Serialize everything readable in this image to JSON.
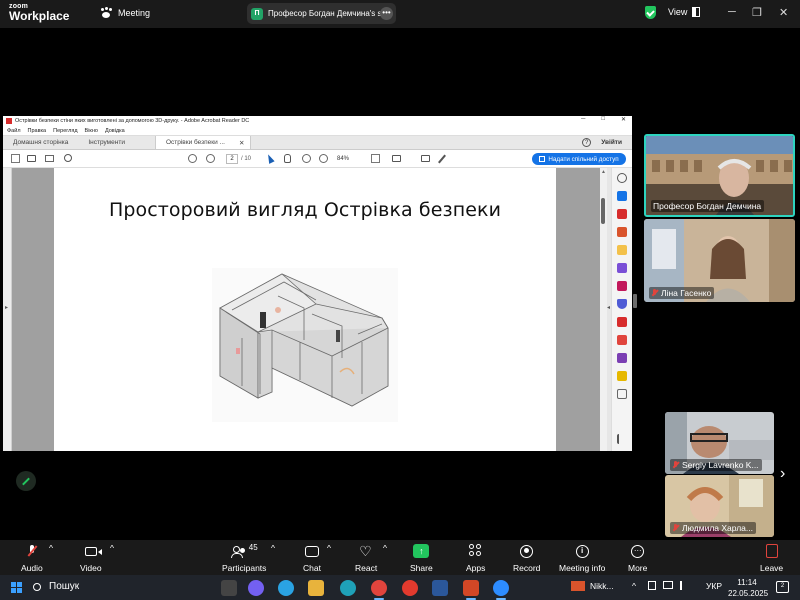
{
  "zoom": {
    "logo_line1": "zoom",
    "logo_line2": "Workplace",
    "meeting_label": "Meeting",
    "share_pill_initial": "П",
    "share_pill_text": "Професор Богдан Демчина's sc",
    "share_pill_more": "•••",
    "view_label": "View",
    "win_controls": [
      "─",
      "❐",
      "✕"
    ]
  },
  "acrobat": {
    "window_title": "Острівки безпеки стіни яких виготовлені за допомогою 3D-друку. - Adobe Acrobat Reader DC",
    "window_controls": [
      "─",
      "□",
      "✕"
    ],
    "menu": [
      "Файл",
      "Правка",
      "Перегляд",
      "Вікно",
      "Довідка"
    ],
    "tabs": [
      "Домашня сторінка",
      "Інструменти"
    ],
    "active_tab": "Острівки безпеки ...",
    "tab_close": "✕",
    "help_label": "?",
    "signin_label": "Увійти",
    "current_page": "2",
    "page_total": "/ 10",
    "zoom_value": "84%",
    "share_button": "Надати спільний доступ",
    "slide_title": "Просторовий вигляд Острівка безпеки",
    "left_arrow": "▸",
    "right_arrow": "◂",
    "scroll_up": "▲"
  },
  "participants": [
    {
      "name": "Професор Богдан Демчина",
      "muted": false
    },
    {
      "name": "Ліна Гасенко",
      "muted": true
    },
    {
      "name": "Sergiy Lavrenko K...",
      "muted": true
    },
    {
      "name": "Людмила Харла...",
      "muted": true
    }
  ],
  "gallery_next": "›",
  "toolbar": {
    "audio": "Audio",
    "video": "Video",
    "participants": "Participants",
    "participants_count": "45",
    "chat": "Chat",
    "react": "React",
    "share": "Share",
    "apps": "Apps",
    "record": "Record",
    "meeting_info": "Meeting info",
    "more": "More",
    "leave": "Leave",
    "caret": "^"
  },
  "taskbar": {
    "search_label": "Пошук",
    "pinned_app_label": "Nikk...",
    "chevron": "^",
    "language": "УКР",
    "time": "11:14",
    "date": "22.05.2025",
    "notifications": "2"
  },
  "colors": {
    "zoom_bg": "#1a1a1a",
    "accent_green": "#22c55e",
    "active_speaker_border": "#2dd4bf",
    "acrobat_blue": "#1473e6",
    "muted_red": "#e0443d",
    "taskbar_bg": "#20242b"
  }
}
